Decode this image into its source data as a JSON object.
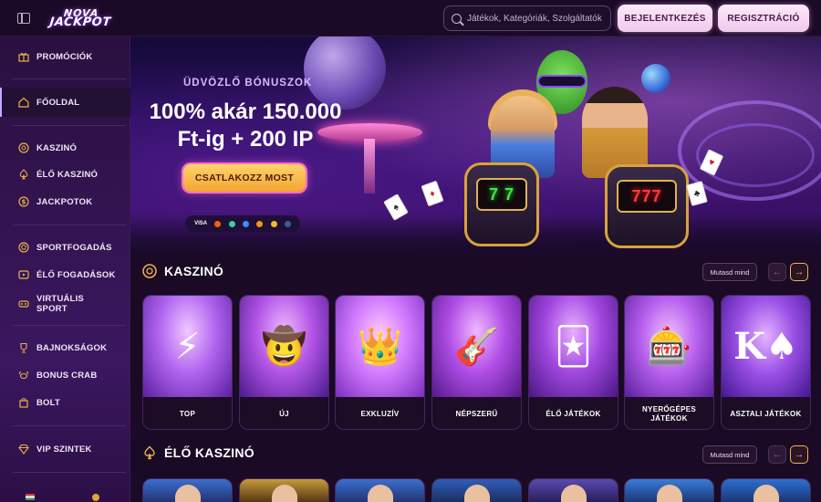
{
  "header": {
    "logo_line1": "NOVA",
    "logo_line2": "JACKPOT",
    "search_placeholder": "Játékok, Kategóriák, Szolgáltatók",
    "login_label": "BEJELENTKEZÉS",
    "register_label": "REGISZTRÁCIÓ"
  },
  "sidebar": {
    "items": [
      {
        "label": "PROMÓCIÓK",
        "icon": "gift-icon"
      },
      {
        "label": "FŐOLDAL",
        "icon": "home-icon",
        "active": true
      },
      {
        "label": "KASZINÓ",
        "icon": "chip-icon"
      },
      {
        "label": "ÉLŐ KASZINÓ",
        "icon": "spade-icon"
      },
      {
        "label": "JACKPOTOK",
        "icon": "coin-icon"
      },
      {
        "label": "SPORTFOGADÁS",
        "icon": "ball-icon"
      },
      {
        "label": "ÉLŐ FOGADÁSOK",
        "icon": "live-icon"
      },
      {
        "label": "VIRTUÁLIS SPORT",
        "icon": "virtual-icon"
      },
      {
        "label": "BAJNOKSÁGOK",
        "icon": "trophy-icon"
      },
      {
        "label": "BONUS CRAB",
        "icon": "crab-icon"
      },
      {
        "label": "BOLT",
        "icon": "shop-icon"
      },
      {
        "label": "VIP SZINTEK",
        "icon": "diamond-icon"
      }
    ]
  },
  "hero": {
    "eyebrow": "ÜDVÖZLŐ BÓNUSZOK",
    "headline": "100% akár 150.000 Ft-ig + 200 IP",
    "cta_label": "CSATLAKOZZ MOST",
    "payments": [
      "VISA"
    ],
    "slot_left": "7 7",
    "slot_right": "777"
  },
  "casino_section": {
    "title": "KASZINÓ",
    "show_all": "Mutasd mind",
    "tiles": [
      {
        "label": "TOP"
      },
      {
        "label": "ÚJ"
      },
      {
        "label": "EXKLUZÍV"
      },
      {
        "label": "NÉPSZERŰ"
      },
      {
        "label": "ÉLŐ JÁTÉKOK"
      },
      {
        "label": "NYERŐGÉPES JÁTÉKOK"
      },
      {
        "label": "ASZTALI JÁTÉKOK"
      }
    ]
  },
  "live_section": {
    "title": "ÉLŐ KASZINÓ",
    "show_all": "Mutasd mind"
  },
  "colors": {
    "accent_gold": "#f0b44a",
    "sidebar_bg": "#331451",
    "page_bg": "#1a0a25"
  }
}
